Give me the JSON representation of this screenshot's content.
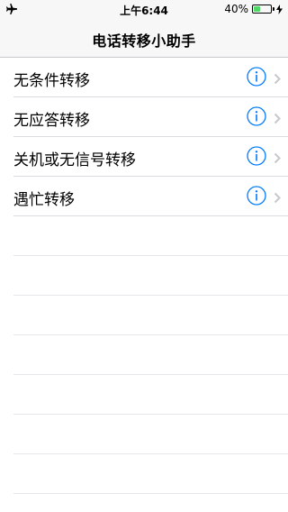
{
  "status_bar": {
    "left_icon": "airplane-icon",
    "time": "上午6:44",
    "battery_percent_label": "40%",
    "battery_level": 0.4,
    "charging_icon": "bolt-icon"
  },
  "nav": {
    "title": "电话转移小助手"
  },
  "rows": [
    {
      "label": "无条件转移",
      "info_icon": "info-icon",
      "chevron_icon": "chevron-right-icon"
    },
    {
      "label": "无应答转移",
      "info_icon": "info-icon",
      "chevron_icon": "chevron-right-icon"
    },
    {
      "label": "关机或无信号转移",
      "info_icon": "info-icon",
      "chevron_icon": "chevron-right-icon"
    },
    {
      "label": "遇忙转移",
      "info_icon": "info-icon",
      "chevron_icon": "chevron-right-icon"
    }
  ],
  "colors": {
    "accent": "#007aff",
    "battery_green": "#4cd964",
    "bar_bg": "#f7f7f7",
    "separator": "#dcdce0",
    "chevron": "#c7c7cc"
  }
}
